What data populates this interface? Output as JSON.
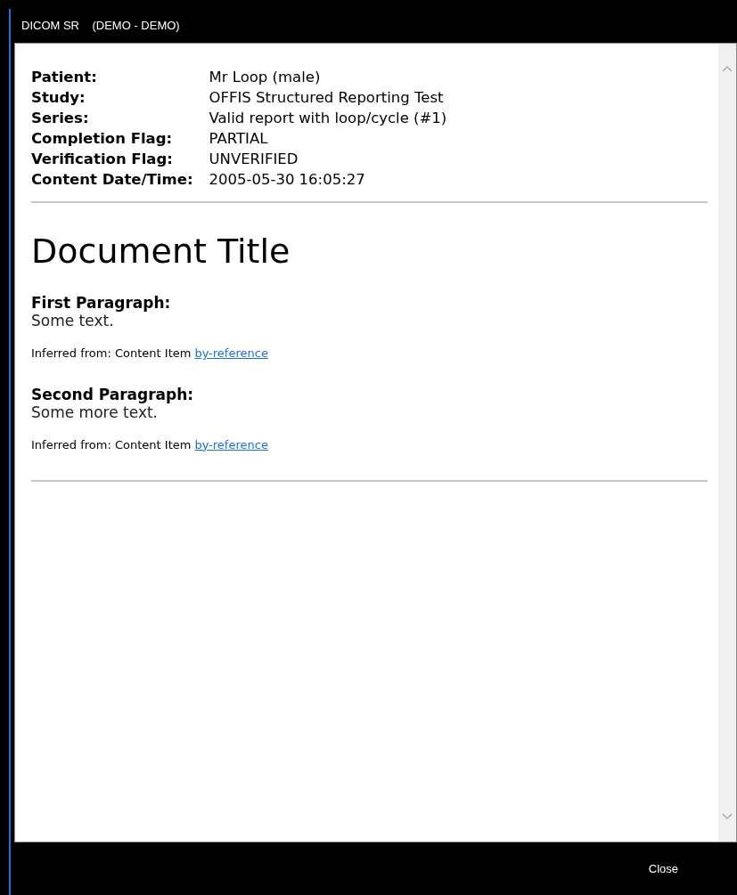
{
  "window": {
    "title": "DICOM SR    (DEMO - DEMO)"
  },
  "header": [
    {
      "label": "Patient:",
      "value": "Mr Loop (male)"
    },
    {
      "label": "Study:",
      "value": "OFFIS Structured Reporting Test"
    },
    {
      "label": "Series:",
      "value": "Valid report with loop/cycle (#1)"
    },
    {
      "label": "Completion Flag:",
      "value": "PARTIAL"
    },
    {
      "label": "Verification Flag:",
      "value": "UNVERIFIED"
    },
    {
      "label": "Content Date/Time:",
      "value": "2005-05-30 16:05:27"
    }
  ],
  "document": {
    "title": "Document Title",
    "sections": [
      {
        "heading": "First Paragraph:",
        "text": "Some text.",
        "note": "Inferred from: Content Item",
        "link": "by-reference"
      },
      {
        "heading": "Second Paragraph:",
        "text": "Some more text.",
        "note": "Inferred from: Content Item",
        "link": "by-reference"
      }
    ]
  },
  "footer": {
    "button": "Close"
  }
}
